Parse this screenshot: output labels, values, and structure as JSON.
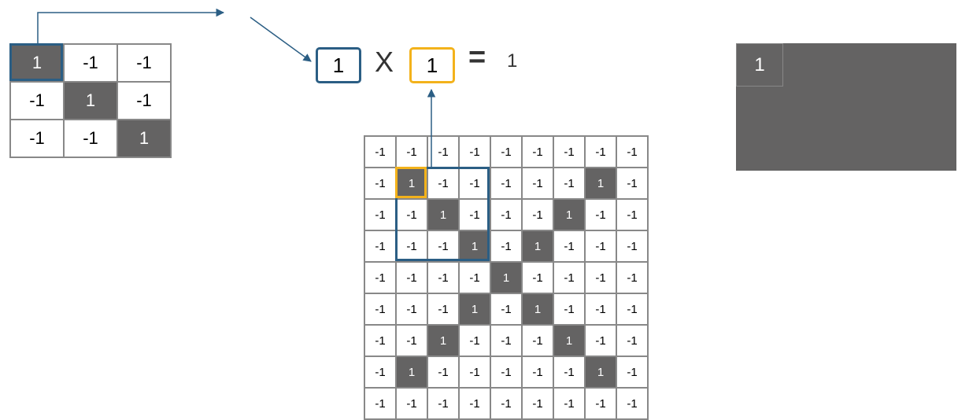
{
  "filter": {
    "values": [
      [
        1,
        -1,
        -1
      ],
      [
        -1,
        1,
        -1
      ],
      [
        -1,
        -1,
        1
      ]
    ],
    "highlight_pos": [
      0,
      0
    ]
  },
  "image": {
    "values": [
      [
        -1,
        -1,
        -1,
        -1,
        -1,
        -1,
        -1,
        -1,
        -1
      ],
      [
        -1,
        1,
        -1,
        -1,
        -1,
        -1,
        -1,
        1,
        -1
      ],
      [
        -1,
        -1,
        1,
        -1,
        -1,
        -1,
        1,
        -1,
        -1
      ],
      [
        -1,
        -1,
        -1,
        1,
        -1,
        1,
        -1,
        -1,
        -1
      ],
      [
        -1,
        -1,
        -1,
        -1,
        1,
        -1,
        -1,
        -1,
        -1
      ],
      [
        -1,
        -1,
        -1,
        1,
        -1,
        1,
        -1,
        -1,
        -1
      ],
      [
        -1,
        -1,
        1,
        -1,
        -1,
        -1,
        1,
        -1,
        -1
      ],
      [
        -1,
        1,
        -1,
        -1,
        -1,
        -1,
        -1,
        1,
        -1
      ],
      [
        -1,
        -1,
        -1,
        -1,
        -1,
        -1,
        -1,
        -1,
        -1
      ]
    ],
    "blue_sel": {
      "row": 1,
      "col": 1,
      "rows": 3,
      "cols": 3
    },
    "gold_sel": {
      "row": 1,
      "col": 1
    }
  },
  "equation": {
    "a": "1",
    "op": "X",
    "b": "1",
    "eq": "=",
    "result": "1"
  },
  "output": {
    "values": [
      [
        1
      ]
    ]
  }
}
